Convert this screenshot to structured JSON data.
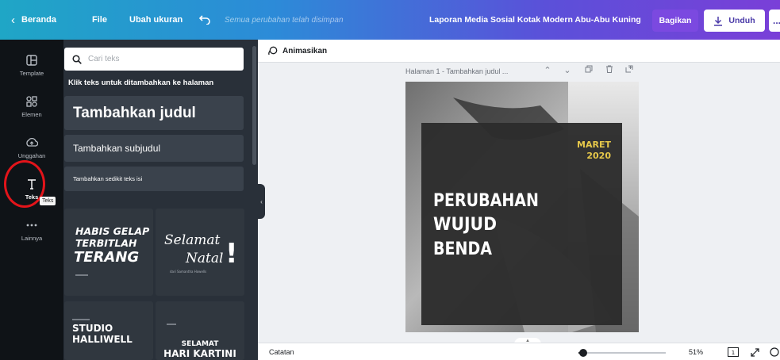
{
  "topbar": {
    "back_label": "Beranda",
    "file_label": "File",
    "resize_label": "Ubah ukuran",
    "undo_icon": "undo-icon",
    "save_status": "Semua perubahan telah disimpan",
    "doc_title": "Laporan Media Sosial Kotak Modern Abu-Abu Kuning",
    "share_label": "Bagikan",
    "download_label": "Unduh",
    "more_label": "..."
  },
  "rail": {
    "items": [
      {
        "label": "Template",
        "icon": "template-icon"
      },
      {
        "label": "Elemen",
        "icon": "elements-icon"
      },
      {
        "label": "Unggahan",
        "icon": "upload-icon"
      },
      {
        "label": "Teks",
        "icon": "text-icon"
      },
      {
        "label": "Lainnya",
        "icon": "more-icon"
      }
    ],
    "tooltip": "Teks"
  },
  "panel": {
    "search_placeholder": "Cari teks",
    "hint": "Klik teks untuk ditambahkan ke halaman",
    "heading_btn": "Tambahkan judul",
    "subheading_btn": "Tambahkan subjudul",
    "body_btn": "Tambahkan sedikit teks isi",
    "combos": [
      {
        "lines": [
          "HABIS GELAP",
          "TERBITLAH",
          "TERANG"
        ]
      },
      {
        "lines": [
          "Selamat",
          "Natal",
          "!"
        ],
        "sub": "dari Samantha Howells"
      },
      {
        "lines": [
          "STUDIO",
          "HALLIWELL"
        ]
      },
      {
        "lines": [
          "SELAMAT",
          "HARI KARTINI"
        ]
      }
    ]
  },
  "workspace": {
    "animate_label": "Animasikan",
    "page_title": "Halaman 1 - Tambahkan judul ...",
    "design": {
      "month": "MARET",
      "year": "2020",
      "headline": [
        "PERUBAHAN",
        "WUJUD",
        "BENDA"
      ]
    }
  },
  "bottombar": {
    "notes_label": "Catatan",
    "zoom": "51%",
    "zoom_fraction": 0.05,
    "page_count": "1"
  },
  "colors": {
    "accent_yellow": "#e6c84a",
    "rail_bg": "#0f1317",
    "panel_bg": "#293039",
    "highlight_red": "#e3141a"
  }
}
